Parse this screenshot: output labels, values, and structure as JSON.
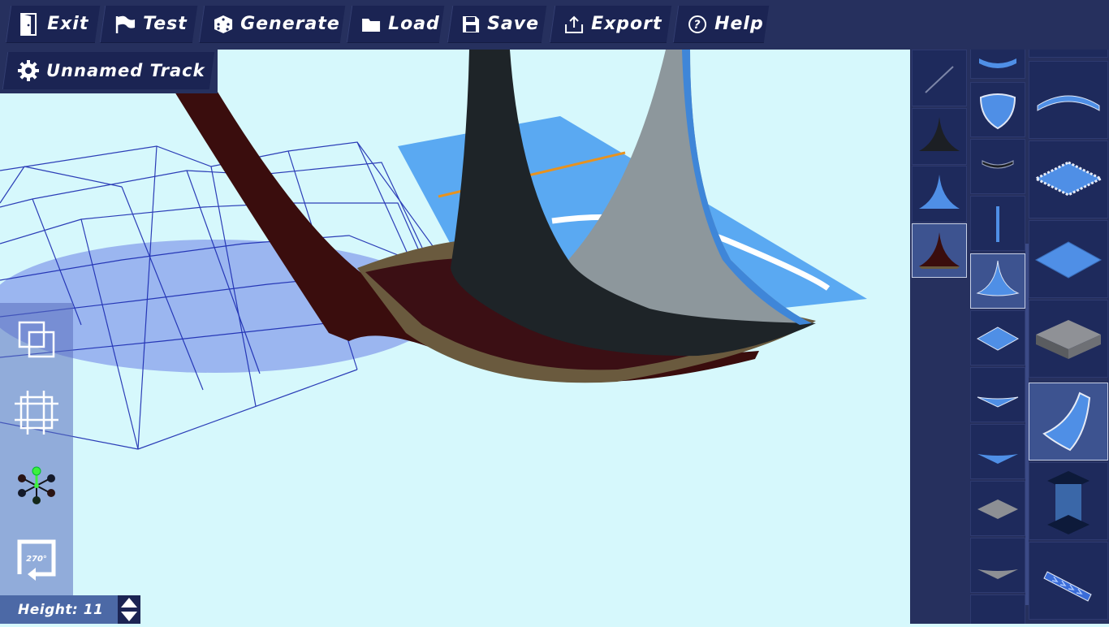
{
  "toolbar": {
    "exit": "Exit",
    "test": "Test",
    "generate": "Generate",
    "load": "Load",
    "save": "Save",
    "export": "Export",
    "help": "Help"
  },
  "track": {
    "name": "Unnamed Track"
  },
  "left_tools": {
    "rotate_label": "270°"
  },
  "height": {
    "label": "Height: 11"
  },
  "palette": {
    "selected_col1": "dark-red-spike",
    "selected_col2": "blue-spike",
    "selected_col3": "curved-ramp"
  },
  "colors": {
    "bar": "#26305e",
    "button": "#1b2453",
    "sky": "#d6f8fc",
    "accent_blue": "#4f8fe6",
    "wire": "#1a2ab0"
  }
}
